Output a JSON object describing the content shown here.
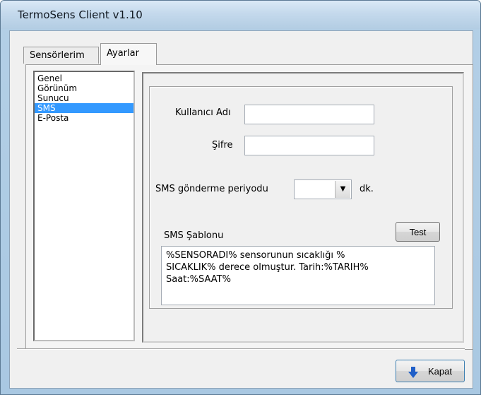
{
  "window": {
    "title": "TermoSens Client v1.10"
  },
  "tabs": [
    {
      "label": "Sensörlerim",
      "active": false
    },
    {
      "label": "Ayarlar",
      "active": true
    }
  ],
  "sidebar": {
    "items": [
      {
        "label": "Genel"
      },
      {
        "label": "Görünüm"
      },
      {
        "label": "Sunucu"
      },
      {
        "label": "SMS",
        "selected": true
      },
      {
        "label": "E-Posta"
      }
    ]
  },
  "sms_settings": {
    "username_label": "Kullanıcı Adı",
    "username_value": "",
    "password_label": "Şifre",
    "password_value": "",
    "period_label": "SMS gönderme periyodu",
    "period_value": "",
    "period_unit": "dk.",
    "template_label": "SMS Şablonu",
    "test_label": "Test",
    "template_text": "%SENSORADI% sensorunun sıcaklığı %\nSICAKLIK% derece olmuştur. Tarih:%TARIH%\nSaat:%SAAT%"
  },
  "footer": {
    "close_label": "Kapat"
  },
  "colors": {
    "selection": "#3399ff",
    "close_arrow": "#1f5fc8"
  }
}
